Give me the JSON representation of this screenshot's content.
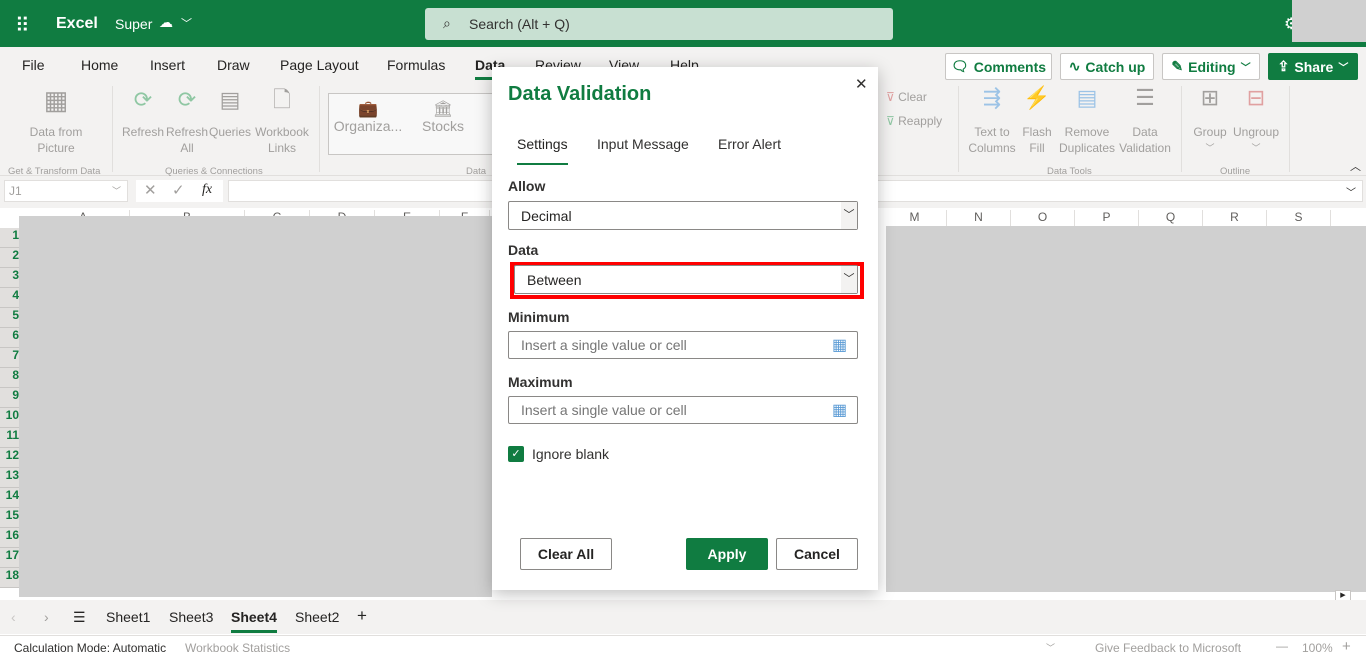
{
  "app": {
    "name": "Excel",
    "doc_name": "Super",
    "search_placeholder": "Search (Alt + Q)"
  },
  "colors": {
    "brand": "#107c41",
    "highlight": "#ff0000"
  },
  "menu_tabs": [
    "File",
    "Home",
    "Insert",
    "Draw",
    "Page Layout",
    "Formulas",
    "Data",
    "Review",
    "View",
    "Help"
  ],
  "active_tab": "Data",
  "header_buttons": {
    "comments": "Comments",
    "catch_up": "Catch up",
    "editing": "Editing",
    "share": "Share"
  },
  "ribbon": {
    "data_from_picture": "Data from Picture",
    "get_transform": "Get & Transform Data",
    "refresh": "Refresh",
    "refresh_all": "Refresh All",
    "queries": "Queries",
    "workbook_links": "Workbook Links",
    "queries_connections": "Queries & Connections",
    "organiza": "Organiza...",
    "stocks": "Stocks",
    "data_types": "Data",
    "clear": "Clear",
    "reapply": "Reapply",
    "text_to_columns": "Text to Columns",
    "flash_fill": "Flash Fill",
    "remove_duplicates": "Remove Duplicates",
    "data_validation": "Data Validation",
    "data_tools": "Data Tools",
    "group": "Group",
    "ungroup": "Ungroup",
    "outline": "Outline"
  },
  "formula_bar": {
    "name_box": "J1",
    "fx": "fx",
    "value": ""
  },
  "columns_left": [
    "A",
    "B",
    "C",
    "D",
    "E",
    "F"
  ],
  "columns_right": [
    "M",
    "N",
    "O",
    "P",
    "Q",
    "R",
    "S"
  ],
  "rows": [
    "1",
    "2",
    "3",
    "4",
    "5",
    "6",
    "7",
    "8",
    "9",
    "10",
    "11",
    "12",
    "13",
    "14",
    "15",
    "16",
    "17",
    "18"
  ],
  "sheets": [
    "Sheet1",
    "Sheet3",
    "Sheet4",
    "Sheet2"
  ],
  "active_sheet": "Sheet4",
  "status": {
    "calc_mode": "Calculation Mode: Automatic",
    "workbook_stats": "Workbook Statistics",
    "feedback": "Give Feedback to Microsoft",
    "zoom": "100%"
  },
  "dialog": {
    "title": "Data Validation",
    "tabs": [
      "Settings",
      "Input Message",
      "Error Alert"
    ],
    "active_tab": "Settings",
    "allow_label": "Allow",
    "allow_value": "Decimal",
    "data_label": "Data",
    "data_value": "Between",
    "minimum_label": "Minimum",
    "minimum_placeholder": "Insert a single value or cell",
    "maximum_label": "Maximum",
    "maximum_placeholder": "Insert a single value or cell",
    "ignore_blank_label": "Ignore blank",
    "ignore_blank_checked": true,
    "clear_all": "Clear All",
    "apply": "Apply",
    "cancel": "Cancel"
  }
}
